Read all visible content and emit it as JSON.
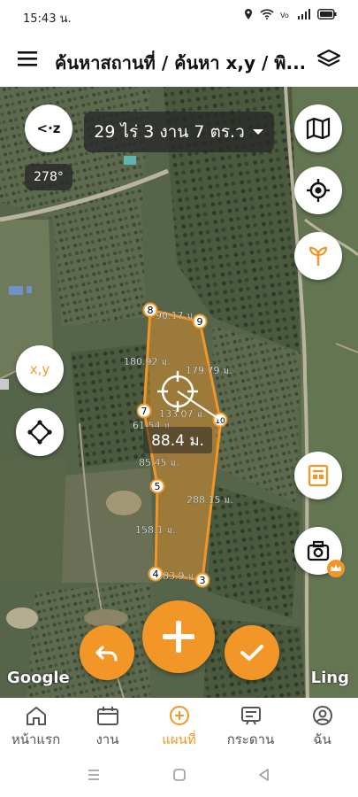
{
  "status": {
    "time": "15:43 น."
  },
  "header": {
    "title": "ค้นหาสถานที่ / ค้นหา x,y / พิ..."
  },
  "map": {
    "area_label": "29 ไร่ 3 งาน 7 ตร.ว",
    "bearing": "278°",
    "xy_label": "x,y",
    "zoom_label": "<·z",
    "current_distance": "88.4 ม.",
    "google_label": "Google",
    "ling_label": "Ling",
    "points": [
      "8",
      "9",
      "7",
      "10",
      "5",
      "4",
      "3"
    ],
    "segments": [
      "90.17 ม.",
      "180.92 ม.",
      "179.79 ม.",
      "133.07 ม.",
      "61.54 ม.",
      "85.45 ม.",
      "288.15 ม.",
      "158.1 ม.",
      "83.9 ม."
    ]
  },
  "nav": {
    "items": [
      {
        "label": "หน้าแรก",
        "icon": "home-icon"
      },
      {
        "label": "งาน",
        "icon": "calendar-icon"
      },
      {
        "label": "แผนที่",
        "icon": "map-plus-icon"
      },
      {
        "label": "กระดาน",
        "icon": "board-icon"
      },
      {
        "label": "ฉัน",
        "icon": "user-icon"
      }
    ]
  },
  "colors": {
    "accent": "#f29627",
    "polygon": "#f29627"
  }
}
